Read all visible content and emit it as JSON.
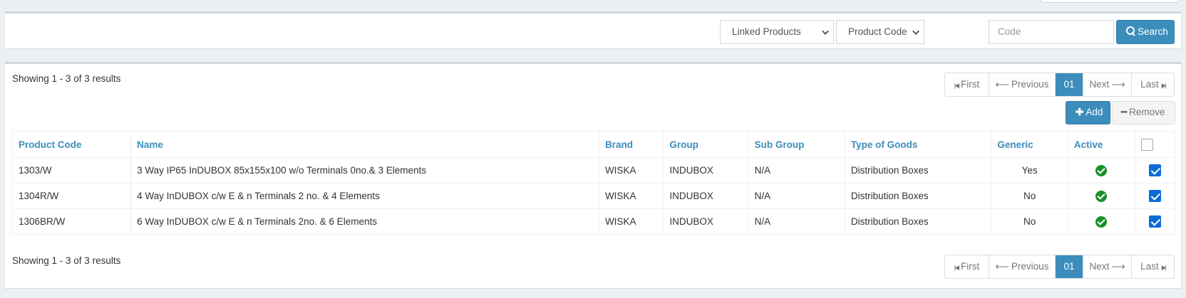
{
  "search_bar": {
    "linked_select": "Linked Products",
    "field_select": "Product Code",
    "code_placeholder": "Code",
    "search_label": "Search"
  },
  "results": {
    "summary": "Showing 1 - 3 of 3 results",
    "pagination": {
      "first": "First",
      "previous": "Previous",
      "current": "01",
      "next": "Next",
      "last": "Last"
    },
    "actions": {
      "add": "Add",
      "remove": "Remove"
    },
    "columns": [
      "Product Code",
      "Name",
      "Brand",
      "Group",
      "Sub Group",
      "Type of Goods",
      "Generic",
      "Active"
    ],
    "rows": [
      {
        "code": "1303/W",
        "name": "3 Way IP65 InDUBOX 85x155x100 w/o Terminals 0no.& 3 Elements",
        "brand": "WISKA",
        "group": "INDUBOX",
        "subgroup": "N/A",
        "type": "Distribution Boxes",
        "generic": "Yes",
        "active": true,
        "selected": true
      },
      {
        "code": "1304R/W",
        "name": "4 Way InDUBOX c/w E & n Terminals 2 no. & 4 Elements",
        "brand": "WISKA",
        "group": "INDUBOX",
        "subgroup": "N/A",
        "type": "Distribution Boxes",
        "generic": "No",
        "active": true,
        "selected": true
      },
      {
        "code": "1306BR/W",
        "name": "6 Way InDUBOX c/w E & n Terminals 2no. & 6 Elements",
        "brand": "WISKA",
        "group": "INDUBOX",
        "subgroup": "N/A",
        "type": "Distribution Boxes",
        "generic": "No",
        "active": true,
        "selected": true
      }
    ],
    "select_all_checked": false
  },
  "colors": {
    "accent": "#3c8dbc",
    "active_green": "#1a8f2a",
    "checkbox_blue": "#0b6bd4"
  }
}
